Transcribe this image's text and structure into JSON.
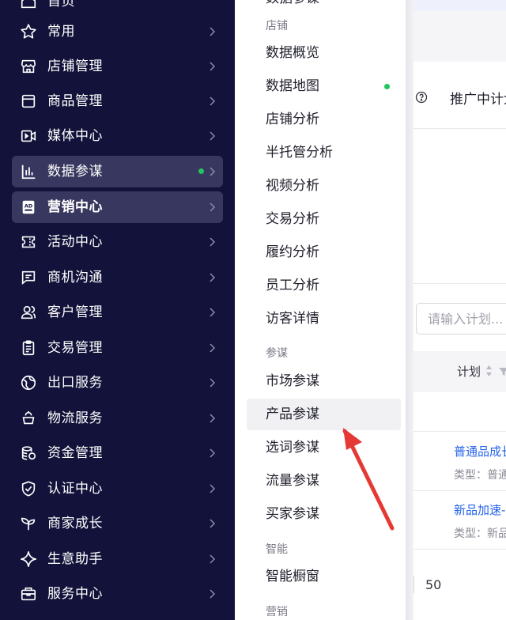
{
  "sidebar": {
    "items": [
      {
        "label": "首页",
        "icon": "home-icon"
      },
      {
        "label": "常用",
        "icon": "star-icon"
      },
      {
        "label": "店铺管理",
        "icon": "store-icon"
      },
      {
        "label": "商品管理",
        "icon": "product-icon"
      },
      {
        "label": "媒体中心",
        "icon": "video-icon"
      },
      {
        "label": "数据参谋",
        "icon": "bar-chart-icon",
        "status_dot": "#22c55e"
      },
      {
        "label": "营销中心",
        "icon": "ad-icon"
      },
      {
        "label": "活动中心",
        "icon": "ticket-icon"
      },
      {
        "label": "商机沟通",
        "icon": "chat-icon"
      },
      {
        "label": "客户管理",
        "icon": "users-icon"
      },
      {
        "label": "交易管理",
        "icon": "clipboard-icon"
      },
      {
        "label": "出口服务",
        "icon": "globe-icon"
      },
      {
        "label": "物流服务",
        "icon": "truck-icon"
      },
      {
        "label": "资金管理",
        "icon": "coins-icon"
      },
      {
        "label": "认证中心",
        "icon": "shield-check-icon"
      },
      {
        "label": "商家成长",
        "icon": "sprout-icon"
      },
      {
        "label": "生意助手",
        "icon": "sparkle-icon"
      },
      {
        "label": "服务中心",
        "icon": "briefcase-icon"
      }
    ]
  },
  "flyout": {
    "top_cut_label": "数据参谋",
    "groups": [
      {
        "title": "店铺",
        "items": [
          "数据概览",
          "数据地图",
          "店铺分析",
          "半托管分析",
          "视频分析",
          "交易分析",
          "履约分析",
          "员工分析",
          "访客详情"
        ]
      },
      {
        "title": "参谋",
        "items": [
          "市场参谋",
          "产品参谋",
          "选词参谋",
          "流量参谋",
          "买家参谋"
        ]
      },
      {
        "title": "智能",
        "items": [
          "智能橱窗"
        ]
      },
      {
        "title": "营销",
        "items": []
      }
    ],
    "new_dot_item": "数据地图",
    "new_dot_color": "#22c55e",
    "highlighted_item": "产品参谋"
  },
  "page": {
    "help_icon": "question-circle-icon",
    "promo_title": "推广中计划",
    "search_placeholder": "请输入计划...",
    "table": {
      "header_plan": "计划",
      "rows": [
        {
          "name": "普通品成长",
          "type": "类型：普通"
        },
        {
          "name": "新品加速-",
          "type": "类型：新品"
        }
      ]
    },
    "pagination_size": "50"
  },
  "annotation": {
    "color": "#e53935",
    "icon": "red-arrow-icon"
  },
  "colors": {
    "sidebar_bg": "#12123a",
    "sidebar_active": "#37375f",
    "link": "#2563eb",
    "dot": "#22c55e"
  }
}
